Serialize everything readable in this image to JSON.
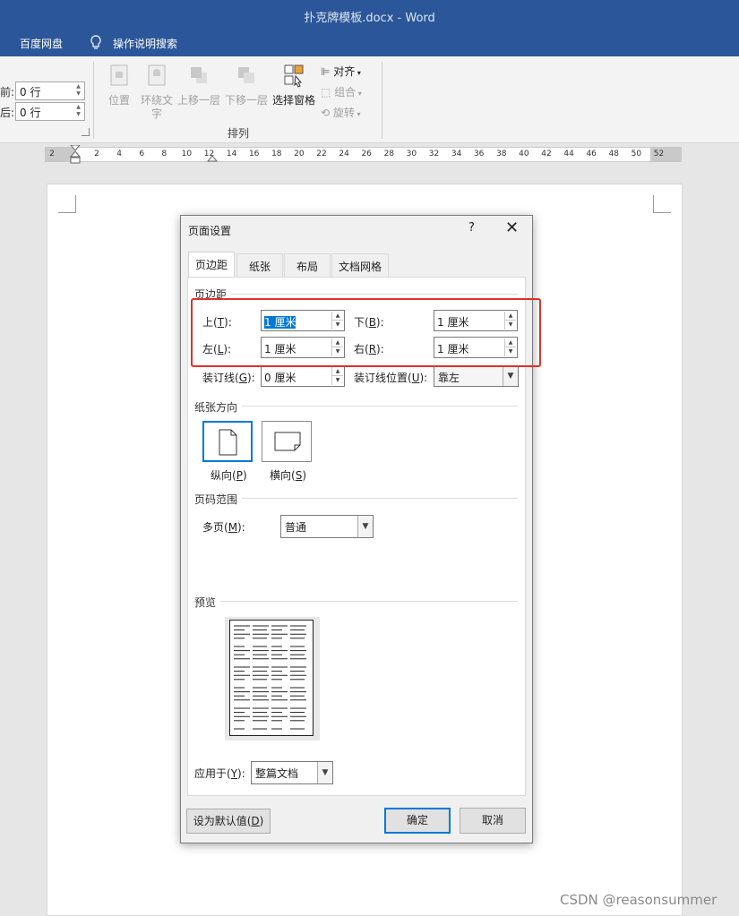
{
  "window": {
    "title": "扑克牌模板.docx  -  Word"
  },
  "menubar": {
    "baidu": "百度网盘",
    "tell_me": "操作说明搜索"
  },
  "ribbon": {
    "spacing": {
      "before_label": "前:",
      "before_value": "0 行",
      "after_label": "后:",
      "after_value": "0 行"
    },
    "buttons": {
      "position": "位置",
      "wrap_text": "环绕文字",
      "bring_forward": "上移一层",
      "send_backward": "下移一层",
      "selection_pane": "选择窗格"
    },
    "small": {
      "align": "对齐",
      "group": "组合",
      "rotate": "旋转"
    },
    "group_label": "排列"
  },
  "ruler": {
    "ticks": [
      "2",
      "2",
      "4",
      "6",
      "8",
      "10",
      "12",
      "14",
      "16",
      "18",
      "20",
      "22",
      "24",
      "26",
      "28",
      "30",
      "32",
      "34",
      "36",
      "38",
      "40",
      "42",
      "44",
      "46",
      "48",
      "50",
      "52"
    ]
  },
  "dialog": {
    "title": "页面设置",
    "help": "?",
    "close": "✕",
    "tabs": [
      "页边距",
      "纸张",
      "布局",
      "文档网格"
    ],
    "margins": {
      "section": "页边距",
      "top_label": "上(",
      "top_key": "T",
      "top_value": "1 厘米",
      "bottom_label": "下(",
      "bottom_key": "B",
      "bottom_value": "1 厘米",
      "left_label": "左(",
      "left_key": "L",
      "left_value": "1 厘米",
      "right_label": "右(",
      "right_key": "R",
      "right_value": "1 厘米",
      "gutter_label": "装订线(",
      "gutter_key": "G",
      "gutter_value": "0 厘米",
      "gutter_pos_label": "装订线位置(",
      "gutter_pos_key": "U",
      "gutter_pos_value": "靠左",
      "label_suffix": "):"
    },
    "orientation": {
      "section": "纸张方向",
      "portrait_label": "纵向(",
      "portrait_key": "P",
      "landscape_label": "横向(",
      "landscape_key": "S",
      "suffix": ")"
    },
    "pages": {
      "section": "页码范围",
      "multi_label": "多页(",
      "multi_key": "M",
      "multi_suffix": "):",
      "multi_value": "普通"
    },
    "preview": {
      "section": "预览"
    },
    "apply": {
      "label": "应用于(",
      "key": "Y",
      "suffix": "):",
      "value": "整篇文档"
    },
    "buttons": {
      "set_default": "设为默认值(",
      "set_default_key": "D",
      "set_default_suffix": ")",
      "ok": "确定",
      "cancel": "取消"
    }
  },
  "watermark": "CSDN @reasonsummer",
  "colors": {
    "titlebar": "#2b579a",
    "accent": "#0078d7",
    "highlight_box": "#e0302a"
  }
}
